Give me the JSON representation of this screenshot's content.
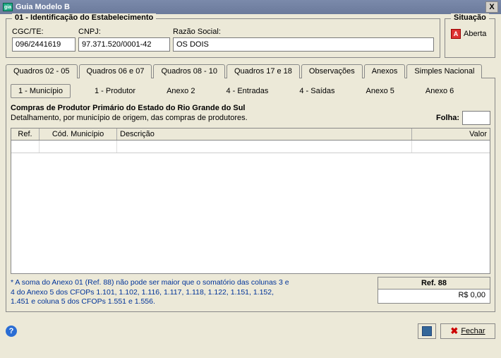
{
  "window": {
    "title": "Guia Modelo B",
    "close": "X"
  },
  "identificacao": {
    "legend": "01 - Identificação do Estabelecimento",
    "cgc_label": "CGC/TE:",
    "cgc_value": "096/2441619",
    "cnpj_label": "CNPJ:",
    "cnpj_value": "97.371.520/0001-42",
    "razao_label": "Razão Social:",
    "razao_value": "OS DOIS"
  },
  "situacao": {
    "legend": "Situação",
    "icon": "A",
    "text": "Aberta"
  },
  "tabs": [
    {
      "label": "Quadros 02 - 05"
    },
    {
      "label": "Quadros 06 e 07"
    },
    {
      "label": "Quadros 08 - 10"
    },
    {
      "label": "Quadros 17 e 18"
    },
    {
      "label": "Observações"
    },
    {
      "label": "Anexos"
    },
    {
      "label": "Simples Nacional"
    }
  ],
  "subtabs": [
    {
      "label": "1 - Município"
    },
    {
      "label": "1 - Produtor"
    },
    {
      "label": "Anexo 2"
    },
    {
      "label": "4 - Entradas"
    },
    {
      "label": "4 - Saídas"
    },
    {
      "label": "Anexo 5"
    },
    {
      "label": "Anexo 6"
    }
  ],
  "section": {
    "title": "Compras de Produtor Primário do Estado do Rio Grande do Sul",
    "subtitle": "Detalhamento, por município de origem, das compras de produtores.",
    "folha_label": "Folha:",
    "folha_value": ""
  },
  "grid": {
    "headers": {
      "ref": "Ref.",
      "cod": "Cód. Município",
      "desc": "Descrição",
      "valor": "Valor"
    },
    "rows": [
      {
        "ref": "",
        "cod": "",
        "desc": "",
        "valor": ""
      }
    ]
  },
  "footnote": "* A soma do Anexo 01 (Ref. 88)  não pode ser maior que  o somatório das colunas 3 e 4 do Anexo 5 dos CFOPs 1.101, 1.102, 1.116, 1.117,  1.118,  1.122,  1.151,  1.152, 1.451 e coluna 5 dos CFOPs  1.551 e 1.556.",
  "ref88": {
    "label": "Ref. 88",
    "value": "R$ 0,00"
  },
  "footer": {
    "help": "?",
    "fechar": "Fechar"
  }
}
